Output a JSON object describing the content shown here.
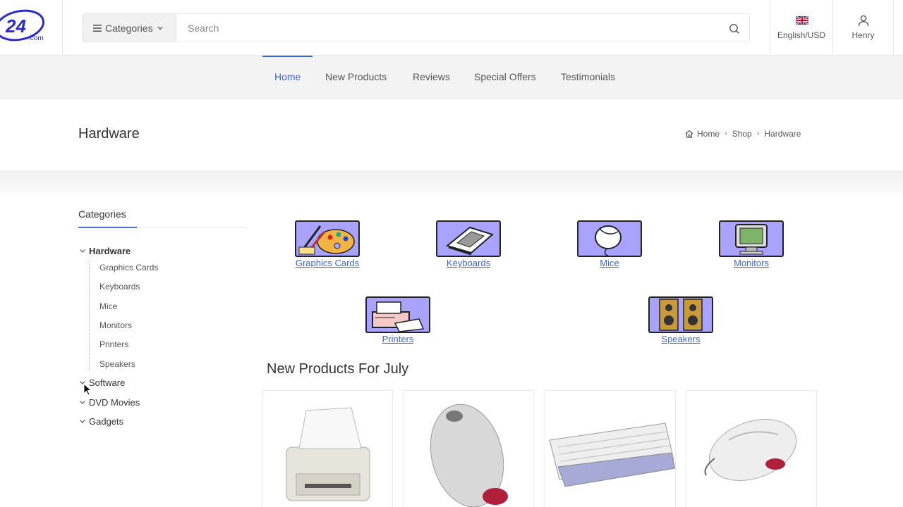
{
  "header": {
    "logo_text": "24",
    "logo_suffix": ".com",
    "categories_label": "Categories",
    "search_placeholder": "Search",
    "language_label": "English/USD",
    "user_label": "Henry"
  },
  "nav": {
    "items": [
      {
        "label": "Home",
        "active": true
      },
      {
        "label": "New Products"
      },
      {
        "label": "Reviews"
      },
      {
        "label": "Special Offers"
      },
      {
        "label": "Testimonials"
      }
    ]
  },
  "page": {
    "title": "Hardware",
    "breadcrumb": [
      "Home",
      "Shop",
      "Hardware"
    ]
  },
  "sidebar": {
    "title": "Categories",
    "tree": [
      {
        "label": "Hardware",
        "expanded": true,
        "children": [
          "Graphics Cards",
          "Keyboards",
          "Mice",
          "Monitors",
          "Printers",
          "Speakers"
        ]
      },
      {
        "label": "Software"
      },
      {
        "label": "DVD Movies"
      },
      {
        "label": "Gadgets"
      }
    ]
  },
  "categories": [
    {
      "label": "Graphics Cards",
      "icon": "paint-palette-icon"
    },
    {
      "label": "Keyboards",
      "icon": "keyboard-icon"
    },
    {
      "label": "Mice",
      "icon": "mouse-icon"
    },
    {
      "label": "Monitors",
      "icon": "monitor-icon"
    },
    {
      "label": "Printers",
      "icon": "printer-icon"
    },
    {
      "label": "Speakers",
      "icon": "speakers-icon"
    }
  ],
  "new_products": {
    "title": "New Products For July",
    "items": [
      "printer-image",
      "mouse-image",
      "keyboard-image",
      "mouse-image"
    ]
  },
  "colors": {
    "accent": "#3a66d6",
    "tile_bg": "#a9a3ff"
  }
}
